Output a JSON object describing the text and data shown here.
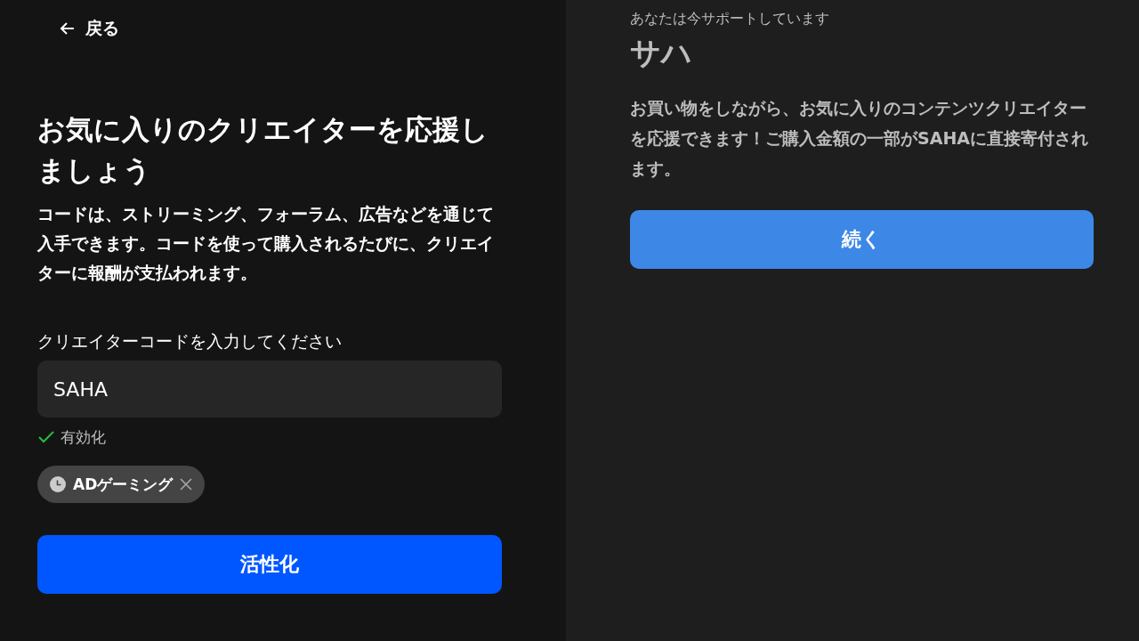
{
  "back": {
    "label": "戻る"
  },
  "title": "お気に入りのクリエイターを応援しましょう",
  "description": "コードは、ストリーミング、フォーラム、広告などを通じて入手できます。コードを使って購入されるたびに、クリエイターに報酬が支払われます。",
  "code_field": {
    "label": "クリエイターコードを入力してください",
    "value": "SAHA",
    "valid": true,
    "status": "有効化"
  },
  "chips": [
    {
      "label": "ADゲーミング"
    }
  ],
  "activate_button": "活性化",
  "support": {
    "caption": "あなたは今サポートしています",
    "name": "サハ",
    "text": "お買い物をしながら、お気に入りのコンテンツクリエイターを応援できます！ご購入金額の一部がSAHAに直接寄付されます。",
    "button": "続く"
  }
}
